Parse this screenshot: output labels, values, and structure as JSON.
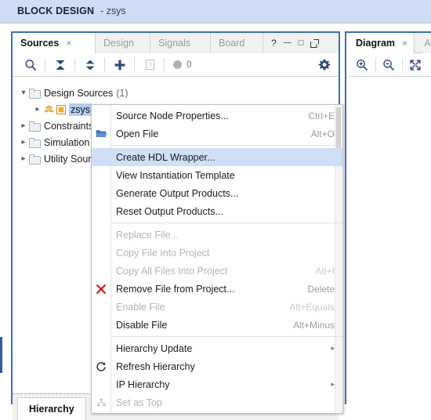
{
  "banner": {
    "title": "BLOCK DESIGN",
    "subtitle": "- zsys"
  },
  "left_dock": {
    "tabs": [
      {
        "label": "Sources",
        "active": true,
        "closable": true
      },
      {
        "label": "Design",
        "active": false,
        "closable": false
      },
      {
        "label": "Signals",
        "active": false,
        "closable": false
      },
      {
        "label": "Board",
        "active": false,
        "closable": false
      }
    ],
    "close_glyph": "×",
    "window_controls": [
      {
        "name": "help-icon",
        "glyph": "?"
      },
      {
        "name": "minimize-icon",
        "glyph": "—"
      },
      {
        "name": "maximize-icon",
        "glyph": "□"
      },
      {
        "name": "float-icon",
        "glyph": "↗"
      }
    ],
    "toolbar": {
      "icons": [
        "search-icon",
        "collapse-all-icon",
        "expand-all-icon",
        "add-sources-icon",
        "help-box-icon"
      ],
      "badge_count": "0"
    },
    "tree": [
      {
        "label": "Design Sources",
        "count": "(1)",
        "expanded": true,
        "indent": 0,
        "icon": "folder-icon"
      },
      {
        "label": "zsys",
        "count": "",
        "expanded": false,
        "indent": 1,
        "icon": "block-design-icon",
        "selected": true
      },
      {
        "label": "Constraints",
        "count": "",
        "expanded": false,
        "indent": 0,
        "icon": "folder-icon"
      },
      {
        "label": "Simulation Sources",
        "count": "",
        "expanded": false,
        "indent": 0,
        "icon": "folder-icon"
      },
      {
        "label": "Utility Sources",
        "count": "",
        "expanded": false,
        "indent": 0,
        "icon": "folder-icon"
      }
    ],
    "bottom_tabs": [
      {
        "label": "Hierarchy",
        "active": true
      }
    ]
  },
  "right_dock": {
    "tab": {
      "label": "Diagram",
      "close_glyph": "×"
    },
    "next_tab_glyph": "A",
    "toolbar_icons": [
      "zoom-in-icon",
      "zoom-out-icon",
      "fit-to-screen-icon"
    ]
  },
  "context_menu": {
    "items": [
      {
        "label": "Source Node Properties...",
        "accel": "Ctrl+E",
        "icon": "",
        "disabled": false,
        "selected": false,
        "submenu": false
      },
      {
        "label": "Open File",
        "accel": "Alt+O",
        "icon": "open-folder-icon",
        "disabled": false,
        "selected": false,
        "submenu": false
      },
      {
        "separator": true
      },
      {
        "label": "Create HDL Wrapper...",
        "accel": "",
        "icon": "",
        "disabled": false,
        "selected": true,
        "submenu": false
      },
      {
        "label": "View Instantiation Template",
        "accel": "",
        "icon": "",
        "disabled": false,
        "selected": false,
        "submenu": false
      },
      {
        "label": "Generate Output Products...",
        "accel": "",
        "icon": "",
        "disabled": false,
        "selected": false,
        "submenu": false
      },
      {
        "label": "Reset Output Products...",
        "accel": "",
        "icon": "",
        "disabled": false,
        "selected": false,
        "submenu": false
      },
      {
        "separator": true
      },
      {
        "label": "Replace File...",
        "accel": "",
        "icon": "",
        "disabled": true,
        "selected": false,
        "submenu": false
      },
      {
        "label": "Copy File Into Project",
        "accel": "",
        "icon": "",
        "disabled": true,
        "selected": false,
        "submenu": false
      },
      {
        "label": "Copy All Files Into Project",
        "accel": "Alt+I",
        "icon": "",
        "disabled": true,
        "selected": false,
        "submenu": false
      },
      {
        "label": "Remove File from Project...",
        "accel": "Delete",
        "icon": "remove-x-icon",
        "disabled": false,
        "selected": false,
        "submenu": false
      },
      {
        "label": "Enable File",
        "accel": "Alt+Equals",
        "icon": "",
        "disabled": true,
        "selected": false,
        "submenu": false
      },
      {
        "label": "Disable File",
        "accel": "Alt+Minus",
        "icon": "",
        "disabled": false,
        "selected": false,
        "submenu": false
      },
      {
        "separator": true
      },
      {
        "label": "Hierarchy Update",
        "accel": "",
        "icon": "",
        "disabled": false,
        "selected": false,
        "submenu": true
      },
      {
        "label": "Refresh Hierarchy",
        "accel": "",
        "icon": "refresh-icon",
        "disabled": false,
        "selected": false,
        "submenu": false
      },
      {
        "label": "IP Hierarchy",
        "accel": "",
        "icon": "",
        "disabled": false,
        "selected": false,
        "submenu": true
      },
      {
        "label": "Set as Top",
        "accel": "",
        "icon": "set-as-top-icon",
        "disabled": true,
        "selected": false,
        "submenu": false
      }
    ],
    "submenu_glyph": "▸"
  },
  "colors": {
    "banner_bg": "#cfddf4",
    "dock_border": "#3b6fb6",
    "selection_blue": "#cfdff5",
    "tree_selection": "#b3cff0",
    "icon_navy": "#2c4a7c",
    "remove_red": "#cc2222",
    "ip_orange": "#f0a830"
  }
}
